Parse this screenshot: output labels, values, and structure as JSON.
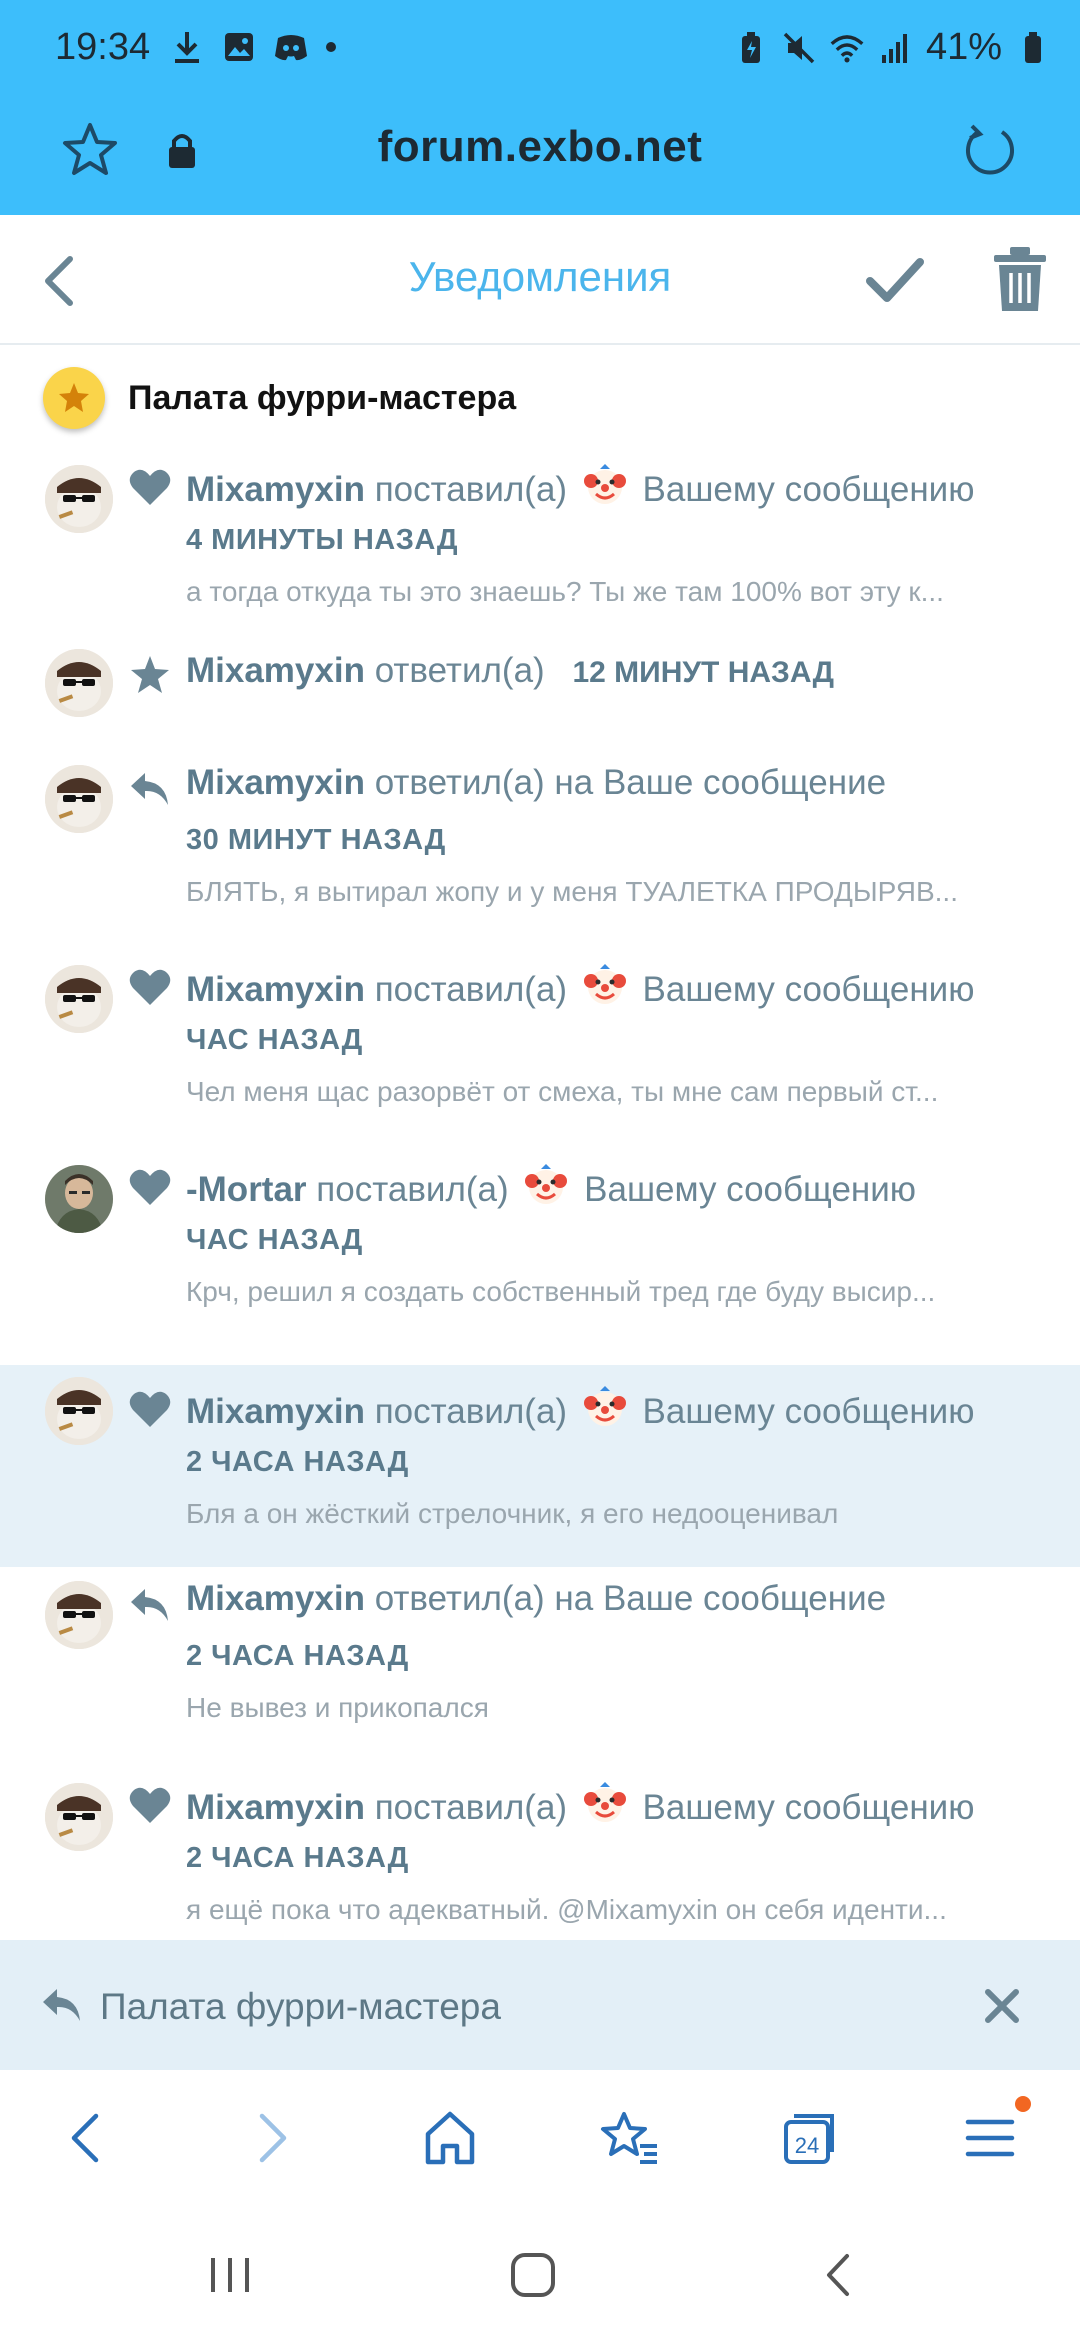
{
  "status_bar": {
    "time": "19:34",
    "battery": "41%"
  },
  "address_bar": {
    "url": "forum.exbo.net"
  },
  "header": {
    "title": "Уведомления"
  },
  "group": {
    "title": "Палата фурри-мастера"
  },
  "notifications": [
    {
      "user": "Mixamyxin",
      "action": "поставил(а)",
      "suffix": "Вашему сообщению",
      "time": "4 МИНУТЫ НАЗАД",
      "excerpt": "а тогда откуда ты это знаешь? Ты же там 100% вот эту к..."
    },
    {
      "user": "Mixamyxin",
      "action": "ответил(а)",
      "time": "12 МИНУТ НАЗАД"
    },
    {
      "user": "Mixamyxin",
      "action": "ответил(а) на Ваше сообщение",
      "time": "30 МИНУТ НАЗАД",
      "excerpt": "БЛЯТЬ, я вытирал жопу и у меня ТУАЛЕТКА ПРОДЫРЯВ..."
    },
    {
      "user": "Mixamyxin",
      "action": "поставил(а)",
      "suffix": "Вашему сообщению",
      "time": "ЧАС НАЗАД",
      "excerpt": "Чел меня щас разорвёт от смеха, ты мне сам первый ст..."
    },
    {
      "user": "-Mortar",
      "action": "поставил(а)",
      "suffix": "Вашему сообщению",
      "time": "ЧАС НАЗАД",
      "excerpt": "Крч, решил я создать собственный тред где буду высир..."
    },
    {
      "user": "Mixamyxin",
      "action": "поставил(а)",
      "suffix": "Вашему сообщению",
      "time": "2 ЧАСА НАЗАД",
      "excerpt": "Бля а он жёсткий стрелочник, я его недооценивал"
    },
    {
      "user": "Mixamyxin",
      "action": "ответил(а) на Ваше сообщение",
      "time": "2 ЧАСА НАЗАД",
      "excerpt": "Не вывез и прикопался"
    },
    {
      "user": "Mixamyxin",
      "action": "поставил(а)",
      "suffix": "Вашему сообщению",
      "time": "2 ЧАСА НАЗАД",
      "excerpt": "я ещё пока что адекватный. @Mixamyxin он себя иденти..."
    }
  ],
  "reply_bar": {
    "text": "Палата фурри-мастера"
  },
  "browser_bar": {
    "tabs_count": "24"
  },
  "colors": {
    "chrome": "#3dbefb",
    "accent": "#4bb5ec",
    "icon": "#6a8594",
    "highlight": "#e6f1f8"
  }
}
